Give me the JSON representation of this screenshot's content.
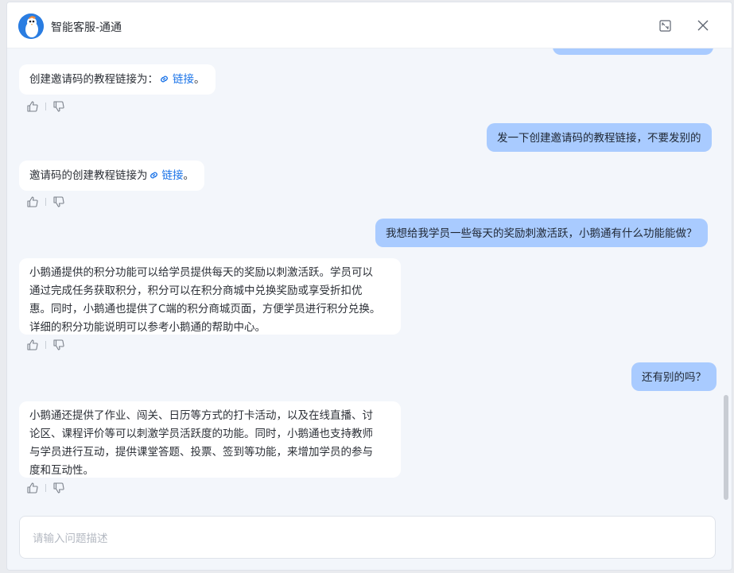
{
  "header": {
    "title": "智能客服-通通",
    "avatar_icon": "penguin-mascot-avatar",
    "expand_icon": "expand-window-icon",
    "close_icon": "close-icon"
  },
  "messages": [
    {
      "role": "bot",
      "text_before": "创建邀请码的教程链接为：",
      "link": "链接",
      "text_after": "。"
    },
    {
      "role": "user",
      "text": "发一下创建邀请码的教程链接，不要发别的"
    },
    {
      "role": "bot",
      "text_before": "邀请码的创建教程链接为",
      "link": "链接",
      "text_after": "。"
    },
    {
      "role": "user",
      "text": "我想给我学员一些每天的奖励刺激活跃，小鹅通有什么功能能做？"
    },
    {
      "role": "bot",
      "lines": [
        "小鹅通提供的积分功能可以给学员提供每天的奖励以刺激活跃。学员可以",
        "通过完成任务获取积分，积分可以在积分商城中兑换奖励或享受折扣优",
        "惠。同时，小鹅通也提供了C端的积分商城页面，方便学员进行积分兑换。",
        "详细的积分功能说明可以参考小鹅通的帮助中心。"
      ]
    },
    {
      "role": "user",
      "text": "还有别的吗？"
    },
    {
      "role": "bot",
      "lines": [
        "小鹅通还提供了作业、闯关、日历等方式的打卡活动，以及在线直播、讨",
        "论区、课程评价等可以刺激学员活跃度的功能。同时，小鹅通也支持教师",
        "与学员进行互动，提供课堂答题、投票、签到等功能，来增加学员的参与",
        "度和互动性。"
      ]
    }
  ],
  "feedback": {
    "like_icon": "thumbs-up-icon",
    "dislike_icon": "thumbs-down-icon"
  },
  "input": {
    "placeholder": "请输入问题描述"
  },
  "colors": {
    "user_bubble": "#a9cbff",
    "bot_bubble": "#ffffff",
    "link": "#1a73e8",
    "background": "#f3f6fb"
  }
}
